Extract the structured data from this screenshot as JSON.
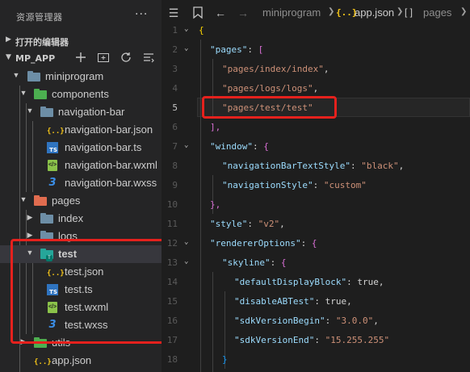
{
  "sidebar": {
    "title": "资源管理器",
    "more_label": "···",
    "open_editors_label": "打开的编辑器",
    "project_label": "MP_APP",
    "actions": [
      "new-file-icon",
      "new-folder-icon",
      "refresh-icon",
      "collapse-all-icon"
    ],
    "tree": [
      {
        "label": "miniprogram",
        "type": "folder",
        "expanded": true
      },
      {
        "label": "components",
        "type": "folder",
        "expanded": true
      },
      {
        "label": "navigation-bar",
        "type": "folder",
        "expanded": true
      },
      {
        "label": "navigation-bar.json",
        "type": "json"
      },
      {
        "label": "navigation-bar.ts",
        "type": "ts"
      },
      {
        "label": "navigation-bar.wxml",
        "type": "wxml"
      },
      {
        "label": "navigation-bar.wxss",
        "type": "wxss"
      },
      {
        "label": "pages",
        "type": "folder",
        "expanded": true
      },
      {
        "label": "index",
        "type": "folder",
        "expanded": false
      },
      {
        "label": "logs",
        "type": "folder",
        "expanded": false
      },
      {
        "label": "test",
        "type": "folder",
        "expanded": true,
        "selected": true
      },
      {
        "label": "test.json",
        "type": "json"
      },
      {
        "label": "test.ts",
        "type": "ts"
      },
      {
        "label": "test.wxml",
        "type": "wxml"
      },
      {
        "label": "test.wxss",
        "type": "wxss"
      },
      {
        "label": "utils",
        "type": "folder",
        "expanded": false
      },
      {
        "label": "app.json",
        "type": "json"
      }
    ]
  },
  "editor": {
    "breadcrumb": {
      "folder": "miniprogram",
      "file": "app.json",
      "symbol": "pages",
      "file_icon": "{..}",
      "symbol_icon": "[ ]"
    },
    "lines": [
      {
        "n": "1",
        "text": "{"
      },
      {
        "n": "2",
        "text": "\"pages\": ["
      },
      {
        "n": "3",
        "text": "\"pages/index/index\","
      },
      {
        "n": "4",
        "text": "\"pages/logs/logs\","
      },
      {
        "n": "5",
        "text": "\"pages/test/test\""
      },
      {
        "n": "6",
        "text": "],"
      },
      {
        "n": "7",
        "text": "\"window\": {"
      },
      {
        "n": "8",
        "text": "\"navigationBarTextStyle\": \"black\","
      },
      {
        "n": "9",
        "text": "\"navigationStyle\": \"custom\""
      },
      {
        "n": "10",
        "text": "},"
      },
      {
        "n": "11",
        "text": "\"style\": \"v2\","
      },
      {
        "n": "12",
        "text": "\"rendererOptions\": {"
      },
      {
        "n": "13",
        "text": "\"skyline\": {"
      },
      {
        "n": "14",
        "text": "\"defaultDisplayBlock\": true,"
      },
      {
        "n": "15",
        "text": "\"disableABTest\": true,"
      },
      {
        "n": "16",
        "text": "\"sdkVersionBegin\": \"3.0.0\","
      },
      {
        "n": "17",
        "text": "\"sdkVersionEnd\": \"15.255.255\""
      },
      {
        "n": "18",
        "text": "}"
      }
    ]
  },
  "colors": {
    "highlight_box": "#e5211d",
    "string": "#ce9178",
    "key": "#9cdcfe",
    "bracket": "#ffd700"
  }
}
